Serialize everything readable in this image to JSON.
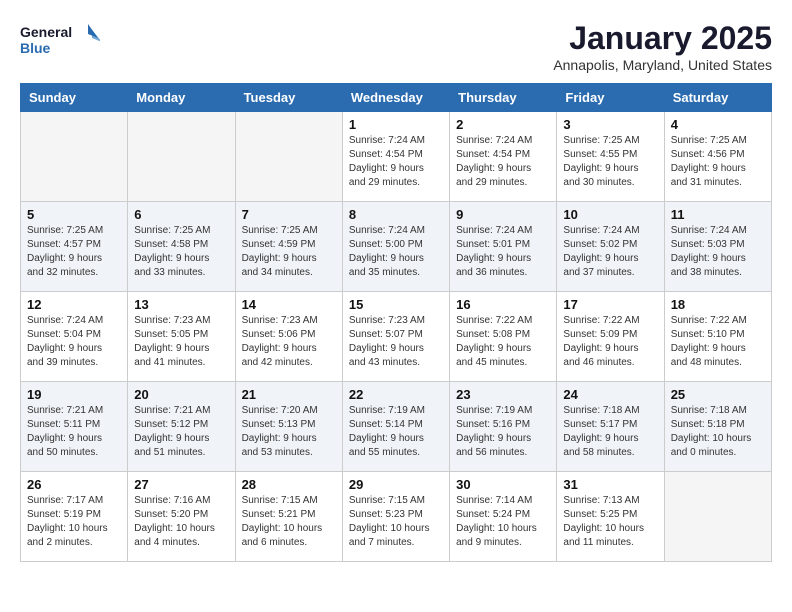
{
  "logo": {
    "line1": "General",
    "line2": "Blue"
  },
  "title": "January 2025",
  "subtitle": "Annapolis, Maryland, United States",
  "days_of_week": [
    "Sunday",
    "Monday",
    "Tuesday",
    "Wednesday",
    "Thursday",
    "Friday",
    "Saturday"
  ],
  "weeks": [
    [
      {
        "num": "",
        "empty": true
      },
      {
        "num": "",
        "empty": true
      },
      {
        "num": "",
        "empty": true
      },
      {
        "num": "1",
        "sunrise": "7:24 AM",
        "sunset": "4:54 PM",
        "daylight": "9 hours and 29 minutes."
      },
      {
        "num": "2",
        "sunrise": "7:24 AM",
        "sunset": "4:54 PM",
        "daylight": "9 hours and 29 minutes."
      },
      {
        "num": "3",
        "sunrise": "7:25 AM",
        "sunset": "4:55 PM",
        "daylight": "9 hours and 30 minutes."
      },
      {
        "num": "4",
        "sunrise": "7:25 AM",
        "sunset": "4:56 PM",
        "daylight": "9 hours and 31 minutes."
      }
    ],
    [
      {
        "num": "5",
        "sunrise": "7:25 AM",
        "sunset": "4:57 PM",
        "daylight": "9 hours and 32 minutes."
      },
      {
        "num": "6",
        "sunrise": "7:25 AM",
        "sunset": "4:58 PM",
        "daylight": "9 hours and 33 minutes."
      },
      {
        "num": "7",
        "sunrise": "7:25 AM",
        "sunset": "4:59 PM",
        "daylight": "9 hours and 34 minutes."
      },
      {
        "num": "8",
        "sunrise": "7:24 AM",
        "sunset": "5:00 PM",
        "daylight": "9 hours and 35 minutes."
      },
      {
        "num": "9",
        "sunrise": "7:24 AM",
        "sunset": "5:01 PM",
        "daylight": "9 hours and 36 minutes."
      },
      {
        "num": "10",
        "sunrise": "7:24 AM",
        "sunset": "5:02 PM",
        "daylight": "9 hours and 37 minutes."
      },
      {
        "num": "11",
        "sunrise": "7:24 AM",
        "sunset": "5:03 PM",
        "daylight": "9 hours and 38 minutes."
      }
    ],
    [
      {
        "num": "12",
        "sunrise": "7:24 AM",
        "sunset": "5:04 PM",
        "daylight": "9 hours and 39 minutes."
      },
      {
        "num": "13",
        "sunrise": "7:23 AM",
        "sunset": "5:05 PM",
        "daylight": "9 hours and 41 minutes."
      },
      {
        "num": "14",
        "sunrise": "7:23 AM",
        "sunset": "5:06 PM",
        "daylight": "9 hours and 42 minutes."
      },
      {
        "num": "15",
        "sunrise": "7:23 AM",
        "sunset": "5:07 PM",
        "daylight": "9 hours and 43 minutes."
      },
      {
        "num": "16",
        "sunrise": "7:22 AM",
        "sunset": "5:08 PM",
        "daylight": "9 hours and 45 minutes."
      },
      {
        "num": "17",
        "sunrise": "7:22 AM",
        "sunset": "5:09 PM",
        "daylight": "9 hours and 46 minutes."
      },
      {
        "num": "18",
        "sunrise": "7:22 AM",
        "sunset": "5:10 PM",
        "daylight": "9 hours and 48 minutes."
      }
    ],
    [
      {
        "num": "19",
        "sunrise": "7:21 AM",
        "sunset": "5:11 PM",
        "daylight": "9 hours and 50 minutes."
      },
      {
        "num": "20",
        "sunrise": "7:21 AM",
        "sunset": "5:12 PM",
        "daylight": "9 hours and 51 minutes."
      },
      {
        "num": "21",
        "sunrise": "7:20 AM",
        "sunset": "5:13 PM",
        "daylight": "9 hours and 53 minutes."
      },
      {
        "num": "22",
        "sunrise": "7:19 AM",
        "sunset": "5:14 PM",
        "daylight": "9 hours and 55 minutes."
      },
      {
        "num": "23",
        "sunrise": "7:19 AM",
        "sunset": "5:16 PM",
        "daylight": "9 hours and 56 minutes."
      },
      {
        "num": "24",
        "sunrise": "7:18 AM",
        "sunset": "5:17 PM",
        "daylight": "9 hours and 58 minutes."
      },
      {
        "num": "25",
        "sunrise": "7:18 AM",
        "sunset": "5:18 PM",
        "daylight": "10 hours and 0 minutes."
      }
    ],
    [
      {
        "num": "26",
        "sunrise": "7:17 AM",
        "sunset": "5:19 PM",
        "daylight": "10 hours and 2 minutes."
      },
      {
        "num": "27",
        "sunrise": "7:16 AM",
        "sunset": "5:20 PM",
        "daylight": "10 hours and 4 minutes."
      },
      {
        "num": "28",
        "sunrise": "7:15 AM",
        "sunset": "5:21 PM",
        "daylight": "10 hours and 6 minutes."
      },
      {
        "num": "29",
        "sunrise": "7:15 AM",
        "sunset": "5:23 PM",
        "daylight": "10 hours and 7 minutes."
      },
      {
        "num": "30",
        "sunrise": "7:14 AM",
        "sunset": "5:24 PM",
        "daylight": "10 hours and 9 minutes."
      },
      {
        "num": "31",
        "sunrise": "7:13 AM",
        "sunset": "5:25 PM",
        "daylight": "10 hours and 11 minutes."
      },
      {
        "num": "",
        "empty": true
      }
    ]
  ]
}
